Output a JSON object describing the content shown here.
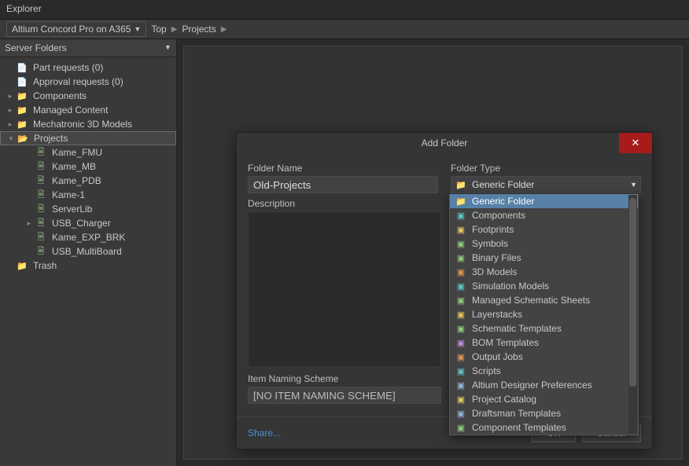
{
  "window_title": "Explorer",
  "breadcrumb": {
    "server": "Altium Concord Pro on A365",
    "path": [
      "Top",
      "Projects"
    ]
  },
  "sidebar": {
    "title": "Server Folders",
    "items": [
      {
        "label": "Part requests (0)",
        "icon": "doc",
        "indent": 0
      },
      {
        "label": "Approval requests (0)",
        "icon": "doc",
        "indent": 0
      },
      {
        "label": "Components",
        "icon": "folder",
        "indent": 0,
        "expandable": true
      },
      {
        "label": "Managed Content",
        "icon": "folder",
        "indent": 0,
        "expandable": true
      },
      {
        "label": "Mechatronic 3D Models",
        "icon": "folder",
        "indent": 0,
        "expandable": true
      },
      {
        "label": "Projects",
        "icon": "folder-open",
        "indent": 0,
        "expandable": true,
        "expanded": true,
        "selected": true
      },
      {
        "label": "Kame_FMU",
        "icon": "proj",
        "indent": 1
      },
      {
        "label": "Kame_MB",
        "icon": "proj",
        "indent": 1
      },
      {
        "label": "Kame_PDB",
        "icon": "proj",
        "indent": 1
      },
      {
        "label": "Kame-1",
        "icon": "proj",
        "indent": 1
      },
      {
        "label": "ServerLib",
        "icon": "proj",
        "indent": 1
      },
      {
        "label": "USB_Charger",
        "icon": "proj",
        "indent": 1,
        "expandable": true
      },
      {
        "label": "Kame_EXP_BRK",
        "icon": "proj",
        "indent": 1
      },
      {
        "label": "USB_MultiBoard",
        "icon": "proj",
        "indent": 1
      },
      {
        "label": "Trash",
        "icon": "trash",
        "indent": 0
      }
    ]
  },
  "dialog": {
    "title": "Add Folder",
    "folder_name_label": "Folder Name",
    "folder_name_value": "Old-Projects",
    "folder_type_label": "Folder Type",
    "folder_type_selected": "Generic Folder",
    "description_label": "Description",
    "naming_label": "Item Naming Scheme",
    "naming_value": "[NO ITEM NAMING SCHEME]",
    "share_link": "Share...",
    "ok": "OK",
    "cancel": "Cancel"
  },
  "dropdown": {
    "items": [
      "Generic Folder",
      "Components",
      "Footprints",
      "Symbols",
      "Binary Files",
      "3D Models",
      "Simulation Models",
      "Managed Schematic Sheets",
      "Layerstacks",
      "Schematic Templates",
      "BOM Templates",
      "Output Jobs",
      "Scripts",
      "Altium Designer Preferences",
      "Project Catalog",
      "Draftsman Templates",
      "Component Templates"
    ],
    "selected_index": 0
  }
}
